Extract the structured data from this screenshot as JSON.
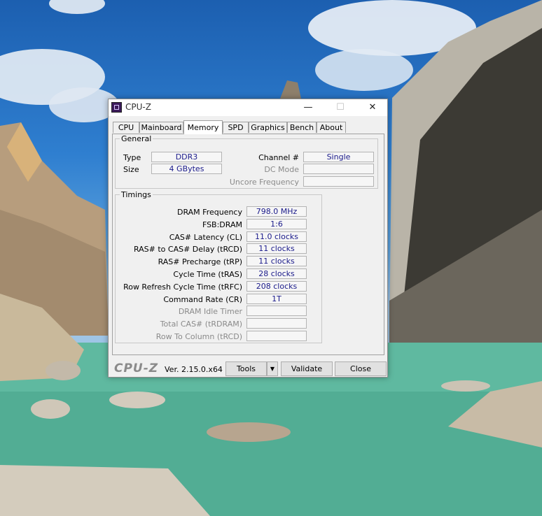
{
  "window": {
    "title": "CPU-Z"
  },
  "titlebar": {
    "minimize": "—",
    "maximize": "☐",
    "close": "✕"
  },
  "tabs": [
    "CPU",
    "Mainboard",
    "Memory",
    "SPD",
    "Graphics",
    "Bench",
    "About"
  ],
  "active_tab": "Memory",
  "general": {
    "legend": "General",
    "type_label": "Type",
    "type_value": "DDR3",
    "size_label": "Size",
    "size_value": "4 GBytes",
    "channel_label": "Channel #",
    "channel_value": "Single",
    "dcmode_label": "DC Mode",
    "dcmode_value": "",
    "uncore_label": "Uncore Frequency",
    "uncore_value": ""
  },
  "timings": {
    "legend": "Timings",
    "rows": [
      {
        "label": "DRAM Frequency",
        "value": "798.0 MHz",
        "enabled": true
      },
      {
        "label": "FSB:DRAM",
        "value": "1:6",
        "enabled": true
      },
      {
        "label": "CAS# Latency (CL)",
        "value": "11.0 clocks",
        "enabled": true
      },
      {
        "label": "RAS# to CAS# Delay (tRCD)",
        "value": "11 clocks",
        "enabled": true
      },
      {
        "label": "RAS# Precharge (tRP)",
        "value": "11 clocks",
        "enabled": true
      },
      {
        "label": "Cycle Time (tRAS)",
        "value": "28 clocks",
        "enabled": true
      },
      {
        "label": "Row Refresh Cycle Time (tRFC)",
        "value": "208 clocks",
        "enabled": true
      },
      {
        "label": "Command Rate (CR)",
        "value": "1T",
        "enabled": true
      },
      {
        "label": "DRAM Idle Timer",
        "value": "",
        "enabled": false
      },
      {
        "label": "Total CAS# (tRDRAM)",
        "value": "",
        "enabled": false
      },
      {
        "label": "Row To Column (tRCD)",
        "value": "",
        "enabled": false
      }
    ]
  },
  "footer": {
    "brand": "CPU-Z",
    "version": "Ver. 2.15.0.x64",
    "tools_label": "Tools",
    "tools_arrow": "▼",
    "validate_label": "Validate",
    "close_label": "Close"
  },
  "colors": {
    "value_text": "#1a1a8a",
    "disabled_text": "#8a8a8a",
    "window_bg": "#f0f0f0"
  }
}
